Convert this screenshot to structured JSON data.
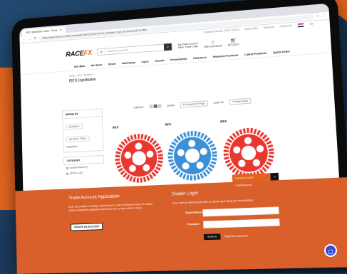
{
  "browser": {
    "tab_title": "RFX Hardware Sale - Race",
    "url": "https://www.racefx.co.uk/rfx-hardware.html?cat_list=1&?rfx_hardware_type_rfx-sprocket&?rfx-filter",
    "utility": [
      "Customer Service 01267 123123",
      "Quick Order",
      "About Us",
      "Contact Us"
    ],
    "lang": "EN"
  },
  "header": {
    "logo_main": "RACE",
    "logo_fx": "FX",
    "search_scope": "All",
    "search_placeholder": "Search for products",
    "account_line1": "My Trade Account",
    "account_line2": "Hello, Trade Login",
    "dealer_label": "FIND A DEALER",
    "cart_label": "MY CART",
    "cart_count": "0"
  },
  "menu": [
    "Dirt Bike",
    "Mx Wear",
    "Street",
    "Workshop",
    "Cycle",
    "Casual",
    "Promotional",
    "Clearance",
    "Featured Products",
    "Latest Products",
    "Quick Order"
  ],
  "page": {
    "breadcrumb": "Home > RFX Hardware",
    "title": "RFX Hardware"
  },
  "sidebar": {
    "refine_label": "REFINE BY",
    "chips": [
      "Sprockets ×",
      "Sprockets - Rear ×"
    ],
    "clear_all": "CLEAR ALL",
    "category_label": "CATEGORY",
    "categories": [
      "Latest Products (4)",
      "All RFX (132)"
    ]
  },
  "toolbar": {
    "view_as": "VIEW AS",
    "show_label": "SHOW",
    "show_value": "20 Products Per Page",
    "sort_label": "SORT BY",
    "sort_value": "Featured Items"
  },
  "products": [
    {
      "brand": "RFX",
      "color": "#e8372f"
    },
    {
      "brand": "RFX",
      "color": "#3b8fd6"
    },
    {
      "brand": "RFX",
      "color": "#e8372f"
    }
  ],
  "cookie": {
    "text": "MANAGE COOKIE PREFERENCES"
  },
  "trade": {
    "title": "Trade Account Application",
    "text": "If you are a dealer & wanting a trade account or wish to become a Race FX stockist please complete the application form below and our team will be in touch.",
    "button": "CREATE AN ACCOUNT"
  },
  "dealer": {
    "title": "Dealer Login",
    "text": "If you have an online account with us, please log in using your email address.",
    "email_label": "Email Address",
    "password_label": "Password",
    "signin": "SIGN IN",
    "forgot": "Forgot your password?"
  },
  "colors": {
    "accent": "#e0631f",
    "band": "#d9602a",
    "chat": "#3b4ad9"
  }
}
